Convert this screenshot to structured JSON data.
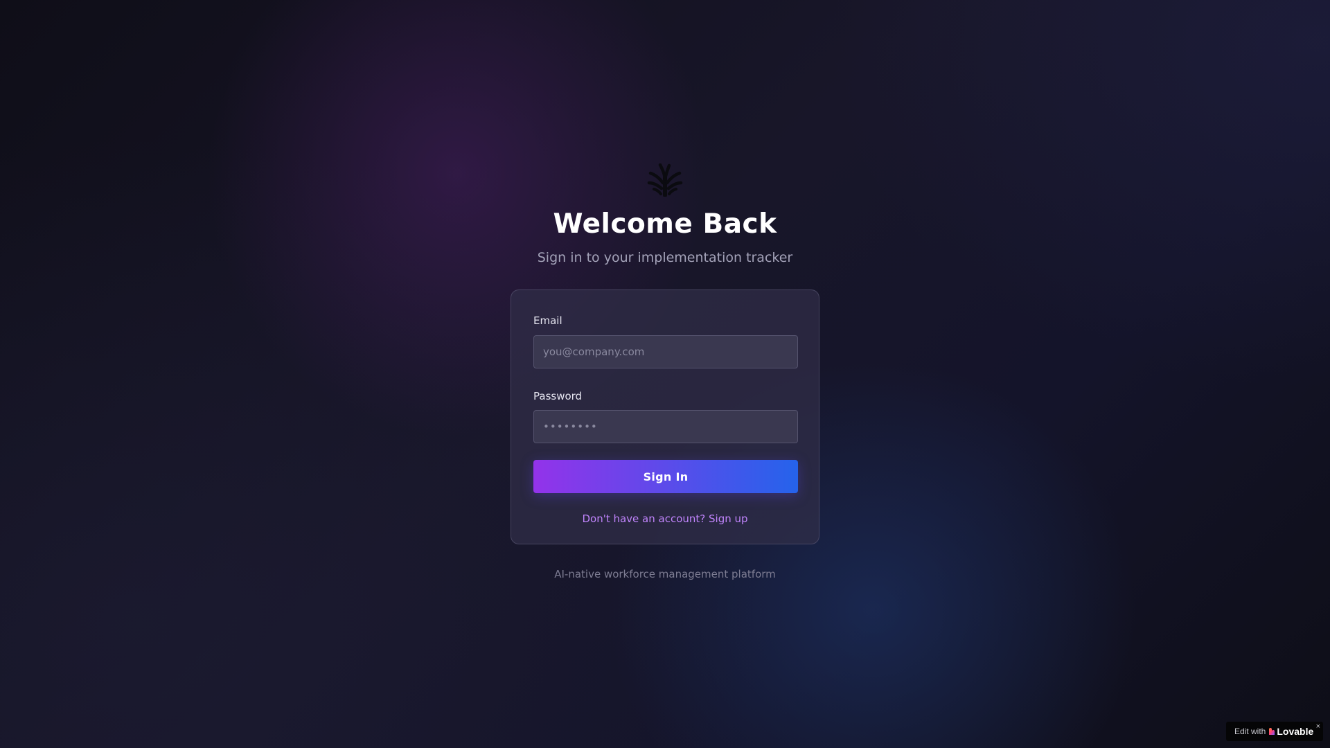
{
  "header": {
    "logo_icon": "stylized-palm-leaf-icon",
    "title": "Welcome Back",
    "subtitle": "Sign in to your implementation tracker"
  },
  "form": {
    "email": {
      "label": "Email",
      "value": "",
      "placeholder": "you@company.com"
    },
    "password": {
      "label": "Password",
      "value": "",
      "placeholder": "••••••••"
    },
    "submit_label": "Sign In",
    "signup_link": "Don't have an account? Sign up"
  },
  "footer": {
    "tagline": "AI-native workforce management platform"
  },
  "badge": {
    "prefix": "Edit with",
    "brand": "Lovable",
    "close": "×"
  },
  "colors": {
    "background": "#13121f",
    "card": "#302e48",
    "button_gradient_start": "#9333ea",
    "button_gradient_end": "#2563eb",
    "link": "#c084fc",
    "logo": "#0b0b10"
  }
}
